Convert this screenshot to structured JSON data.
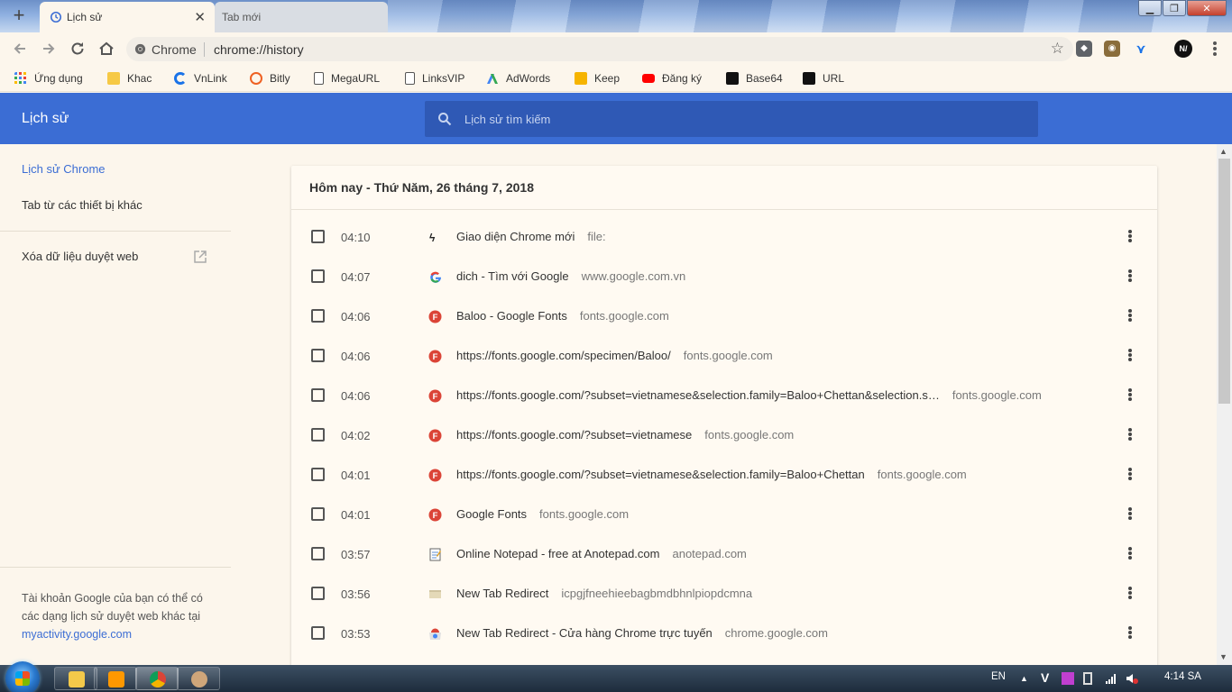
{
  "browser": {
    "tabs": [
      {
        "label": "Lịch sử",
        "active": true,
        "icon": "history-icon"
      },
      {
        "label": "Tab mới",
        "active": false
      }
    ],
    "tab_close_glyph": "✕",
    "new_tab_glyph": "+",
    "window_controls": {
      "minimize": "▁",
      "maximize": "❐",
      "close": "✕"
    },
    "omnibox": {
      "chip": "Chrome",
      "url": "chrome://history"
    },
    "profile_initials": "N/"
  },
  "bookmarks": [
    {
      "label": "Ứng dụng",
      "icon": "apps-grid-icon",
      "color": "#4285f4"
    },
    {
      "label": "Khac",
      "icon": "folder-icon",
      "color": "#f6c945"
    },
    {
      "label": "VnLink",
      "icon": "vnlink-icon",
      "color": "#1a73e8"
    },
    {
      "label": "Bitly",
      "icon": "bitly-icon",
      "color": "#ee6123"
    },
    {
      "label": "MegaURL",
      "icon": "page-icon",
      "color": "#ffffff"
    },
    {
      "label": "LinksVIP",
      "icon": "page-icon",
      "color": "#ffffff"
    },
    {
      "label": "AdWords",
      "icon": "adwords-icon",
      "color": "#4285f4"
    },
    {
      "label": "Keep",
      "icon": "keep-icon",
      "color": "#f6b400"
    },
    {
      "label": "Đăng ký",
      "icon": "youtube-icon",
      "color": "#ff0000"
    },
    {
      "label": "Base64",
      "icon": "base64-icon",
      "color": "#111111"
    },
    {
      "label": "URL",
      "icon": "url-icon",
      "color": "#111111"
    }
  ],
  "header": {
    "title": "Lịch sử",
    "search_placeholder": "Lịch sử tìm kiếm",
    "accent": "#3b6dd4"
  },
  "sidebar": {
    "items": [
      {
        "label": "Lịch sử Chrome",
        "active": true
      },
      {
        "label": "Tab từ các thiết bị khác",
        "active": false
      }
    ],
    "clear_label": "Xóa dữ liệu duyệt web",
    "footer_text": "Tài khoản Google của bạn có thể có các dạng lịch sử duyệt web khác tại",
    "footer_link": "myactivity.google.com"
  },
  "history": {
    "date_heading": "Hôm nay - Thứ Năm, 26 tháng 7, 2018",
    "entries": [
      {
        "time": "04:10",
        "title": "Giao diện Chrome mới",
        "domain": "file:",
        "icon": "nv-logo-icon"
      },
      {
        "time": "04:07",
        "title": "dich - Tìm với Google",
        "domain": "www.google.com.vn",
        "icon": "google-icon"
      },
      {
        "time": "04:06",
        "title": "Baloo - Google Fonts",
        "domain": "fonts.google.com",
        "icon": "google-fonts-icon"
      },
      {
        "time": "04:06",
        "title": "https://fonts.google.com/specimen/Baloo/",
        "domain": "fonts.google.com",
        "icon": "google-fonts-icon"
      },
      {
        "time": "04:06",
        "title": "https://fonts.google.com/?subset=vietnamese&selection.family=Baloo+Chettan&selection.s…",
        "domain": "fonts.google.com",
        "icon": "google-fonts-icon"
      },
      {
        "time": "04:02",
        "title": "https://fonts.google.com/?subset=vietnamese",
        "domain": "fonts.google.com",
        "icon": "google-fonts-icon"
      },
      {
        "time": "04:01",
        "title": "https://fonts.google.com/?subset=vietnamese&selection.family=Baloo+Chettan",
        "domain": "fonts.google.com",
        "icon": "google-fonts-icon"
      },
      {
        "time": "04:01",
        "title": "Google Fonts",
        "domain": "fonts.google.com",
        "icon": "google-fonts-icon"
      },
      {
        "time": "03:57",
        "title": "Online Notepad - free at Anotepad.com",
        "domain": "anotepad.com",
        "icon": "notepad-icon"
      },
      {
        "time": "03:56",
        "title": "New Tab Redirect",
        "domain": "icpgjfneehieebagbmdbhnlpiopdcmna",
        "icon": "extension-icon"
      },
      {
        "time": "03:53",
        "title": "New Tab Redirect - Cửa hàng Chrome trực tuyến",
        "domain": "chrome.google.com",
        "icon": "webstore-icon"
      }
    ]
  },
  "taskbar": {
    "language": "EN",
    "clock": "4:14 SA",
    "apps": [
      "explorer-icon",
      "sublime-icon",
      "chrome-icon",
      "paint-icon"
    ]
  }
}
